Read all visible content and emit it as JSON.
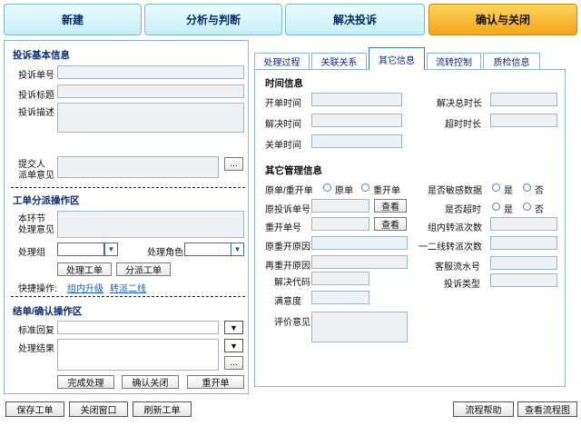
{
  "steps": [
    "新建",
    "分析与判断",
    "解决投诉",
    "确认与关闭"
  ],
  "left": {
    "basic_title": "投诉基本信息",
    "complaint_no": "投诉单号",
    "complaint_title": "投诉标题",
    "complaint_desc": "投诉描述",
    "submitter_l1": "提交人",
    "submitter_l2": "派单意见",
    "ellipsis": "...",
    "dispatch_title": "工单分派操作区",
    "node_l1": "本环节",
    "node_l2": "处理意见",
    "group_label": "处理组",
    "role_label": "处理角色",
    "process_btn": "处理工单",
    "dispatch_btn": "分派工单",
    "quick_label": "快捷操作:",
    "quick_upgrade": "组内升级",
    "quick_transfer": "转派二线",
    "close_title": "结单/确认操作区",
    "std_reply": "标准回复",
    "result": "处理结果",
    "arrow": "▼",
    "complete_btn": "完成处理",
    "confirm_btn": "确认关闭",
    "reopen_btn": "重开单"
  },
  "tabs": [
    "处理过程",
    "关联关系",
    "其它信息",
    "流转控制",
    "质检信息"
  ],
  "right": {
    "time_title": "时间信息",
    "open_time": "开单时间",
    "resolve_total": "解决总时长",
    "resolve_time": "解决时间",
    "overtime": "超时时长",
    "close_time": "关单时间",
    "other_title": "其它管理信息",
    "orig_reopen": "原单/重开单",
    "opt_orig": "原单",
    "opt_reopen": "重开单",
    "sensitive": "是否敏感数据",
    "yes": "是",
    "no": "否",
    "orig_no": "原投诉单号",
    "view": "查看",
    "is_overtime": "是否超时",
    "reopen_no": "重开单号",
    "group_transfer": "组内转派次数",
    "orig_reopen_reason": "原重开原因",
    "l1l2_transfer": "一二线转派次数",
    "re_reopen_reason": "再重开原因",
    "cs_serial": "客服流水号",
    "resolve_code": "解决代码",
    "complaint_type": "投诉类型",
    "satisfaction": "满意度",
    "evaluation": "评价意见"
  },
  "footer": {
    "save": "保存工单",
    "close": "关闭窗口",
    "refresh": "刷新工单",
    "help": "流程帮助",
    "chart": "查看流程图"
  },
  "colors": {
    "active_step": "#f3a51c",
    "step": "#c6eef7",
    "title": "#0d2b7a"
  }
}
